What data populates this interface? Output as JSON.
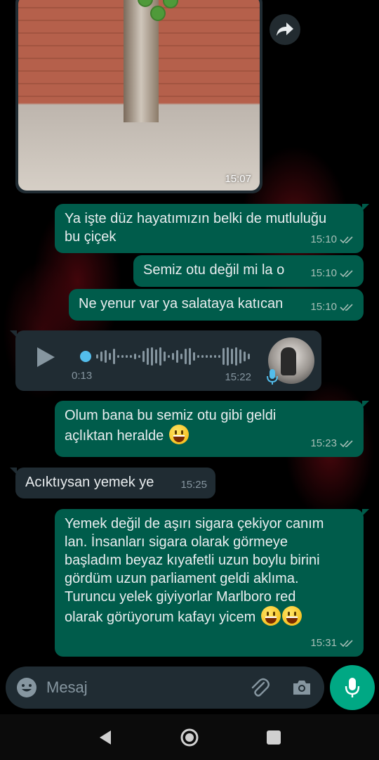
{
  "image_message": {
    "time": "15:07"
  },
  "messages": [
    {
      "dir": "out",
      "text": "Ya işte düz hayatımızın belki de mutluluğu\nbu çiçek",
      "time": "15:10"
    },
    {
      "dir": "out",
      "text": "Semiz otu değil mi la o",
      "time": "15:10"
    },
    {
      "dir": "out",
      "text": "Ne yenur var ya salataya katıcan",
      "time": "15:10"
    },
    {
      "dir": "out",
      "text": "Olum bana bu semiz otu gibi geldi\naçlıktan heralde",
      "time": "15:23"
    },
    {
      "dir": "in",
      "text": "Acıktıysan yemek ye",
      "time": "15:25"
    },
    {
      "dir": "out",
      "text": "Yemek değil de aşırı sigara çekiyor canım\nlan. İnsanları sigara olarak görmeye\nbaşladım beyaz kıyafetli uzun boylu birini\ngördüm uzun parliament geldi aklıma.\nTuruncu yelek giyiyorlar Marlboro red\nolarak görüyorum kafayı yicem",
      "time": "15:31"
    }
  ],
  "voice_message": {
    "position": "0:13",
    "time": "15:22",
    "progress": 0.0
  },
  "input": {
    "placeholder": "Mesaj"
  },
  "colors": {
    "outgoing_bubble": "#005c4b",
    "incoming_bubble": "#202c33",
    "accent": "#00a884",
    "voice_dot": "#53bdeb"
  },
  "icons": [
    "forward-icon",
    "play-icon",
    "mic-icon",
    "emoji-icon",
    "attach-icon",
    "camera-icon",
    "back-nav-icon",
    "home-nav-icon",
    "recents-nav-icon",
    "double-check-icon",
    "grinning-emoji"
  ]
}
